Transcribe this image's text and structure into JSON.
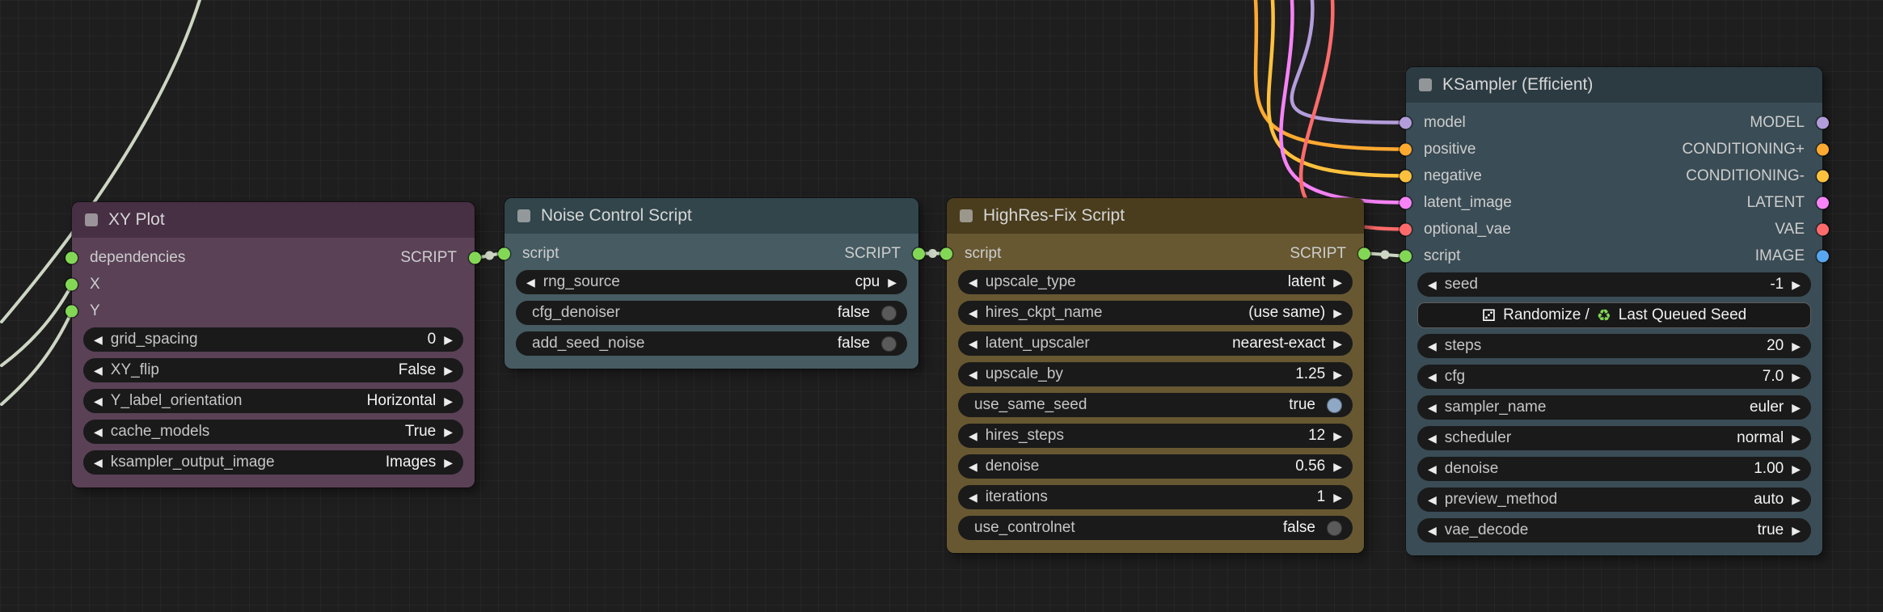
{
  "palette": {
    "slot_green": "#82d855",
    "slot_purple": "#b39ddb",
    "slot_orange": "#ffa931",
    "slot_orange_alt": "#ffc13d",
    "slot_pink": "#f783f7",
    "slot_red": "#ff6b6b",
    "slot_blue": "#58a6f0",
    "wire_pale": "#ccd6c3",
    "widget_bg": "#1a1a1a",
    "toggle_on": "#8fa8c5",
    "toggle_off": "#5a5a5a",
    "node_xy_header": "#472f44",
    "node_xy_body": "#5a4156",
    "node_noise_header": "#31454b",
    "node_noise_body": "#465b62",
    "node_hires_header": "#4a3d1d",
    "node_hires_body": "#675832",
    "node_ksampler_header": "#2c3b42",
    "node_ksampler_body": "#3a4c55"
  },
  "icons": {
    "arrow_left": "◀",
    "arrow_right": "▶",
    "dice": "⚂",
    "recycle": "♻"
  },
  "nodes": [
    {
      "title": "XY Plot",
      "inputs": [
        "dependencies",
        "X",
        "Y"
      ],
      "output": "SCRIPT",
      "widgets": [
        {
          "label": "grid_spacing",
          "value": "0"
        },
        {
          "label": "XY_flip",
          "value": "False"
        },
        {
          "label": "Y_label_orientation",
          "value": "Horizontal"
        },
        {
          "label": "cache_models",
          "value": "True"
        },
        {
          "label": "ksampler_output_image",
          "value": "Images"
        }
      ]
    },
    {
      "title": "Noise Control Script",
      "inputs": [
        "script"
      ],
      "output": "SCRIPT",
      "widgets": [
        {
          "label": "rng_source",
          "value": "cpu"
        },
        {
          "label": "cfg_denoiser",
          "value": "false"
        },
        {
          "label": "add_seed_noise",
          "value": "false"
        }
      ]
    },
    {
      "title": "HighRes-Fix Script",
      "inputs": [
        "script"
      ],
      "output": "SCRIPT",
      "widgets": [
        {
          "label": "upscale_type",
          "value": "latent"
        },
        {
          "label": "hires_ckpt_name",
          "value": "(use same)"
        },
        {
          "label": "latent_upscaler",
          "value": "nearest-exact"
        },
        {
          "label": "upscale_by",
          "value": "1.25"
        },
        {
          "label": "use_same_seed",
          "value": "true"
        },
        {
          "label": "hires_steps",
          "value": "12"
        },
        {
          "label": "denoise",
          "value": "0.56"
        },
        {
          "label": "iterations",
          "value": "1"
        },
        {
          "label": "use_controlnet",
          "value": "false"
        }
      ]
    },
    {
      "title": "KSampler (Efficient)",
      "io_rows": [
        {
          "in": "model",
          "out": "MODEL"
        },
        {
          "in": "positive",
          "out": "CONDITIONING+"
        },
        {
          "in": "negative",
          "out": "CONDITIONING-"
        },
        {
          "in": "latent_image",
          "out": "LATENT"
        },
        {
          "in": "optional_vae",
          "out": "VAE"
        },
        {
          "in": "script",
          "out": "IMAGE"
        }
      ],
      "seed_button": {
        "randomize": "Randomize /",
        "last_queued": "Last Queued Seed"
      },
      "widgets": [
        {
          "label": "seed",
          "value": "-1"
        },
        {
          "label": "steps",
          "value": "20"
        },
        {
          "label": "cfg",
          "value": "7.0"
        },
        {
          "label": "sampler_name",
          "value": "euler"
        },
        {
          "label": "scheduler",
          "value": "normal"
        },
        {
          "label": "denoise",
          "value": "1.00"
        },
        {
          "label": "preview_method",
          "value": "auto"
        },
        {
          "label": "vae_decode",
          "value": "true"
        }
      ]
    }
  ]
}
